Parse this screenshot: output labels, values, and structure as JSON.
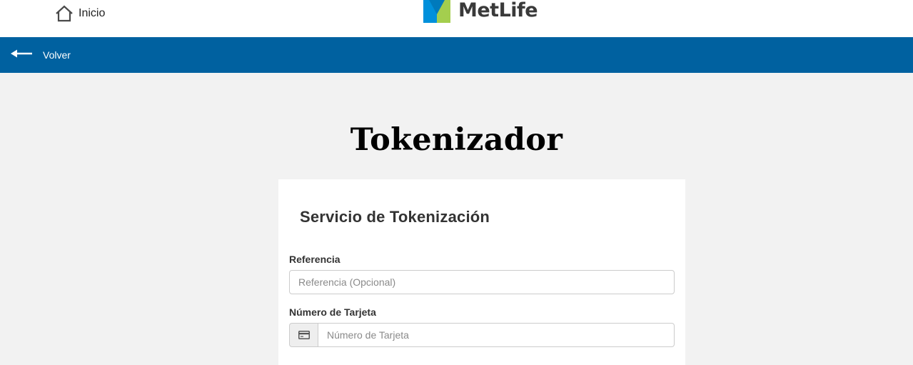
{
  "header": {
    "home_label": "Inicio",
    "brand_name": "MetLife",
    "brand_colors": [
      "#0090da",
      "#a4ce4e",
      "#007abc"
    ]
  },
  "nav": {
    "back_label": "Volver",
    "background_color": "#0061a0"
  },
  "page": {
    "title": "Tokenizador"
  },
  "form": {
    "title": "Servicio de Tokenización",
    "reference": {
      "label": "Referencia",
      "placeholder": "Referencia (Opcional)",
      "value": ""
    },
    "card_number": {
      "label": "Número de Tarjeta",
      "placeholder": "Número de Tarjeta",
      "value": "",
      "icon": "credit-card-icon"
    }
  }
}
